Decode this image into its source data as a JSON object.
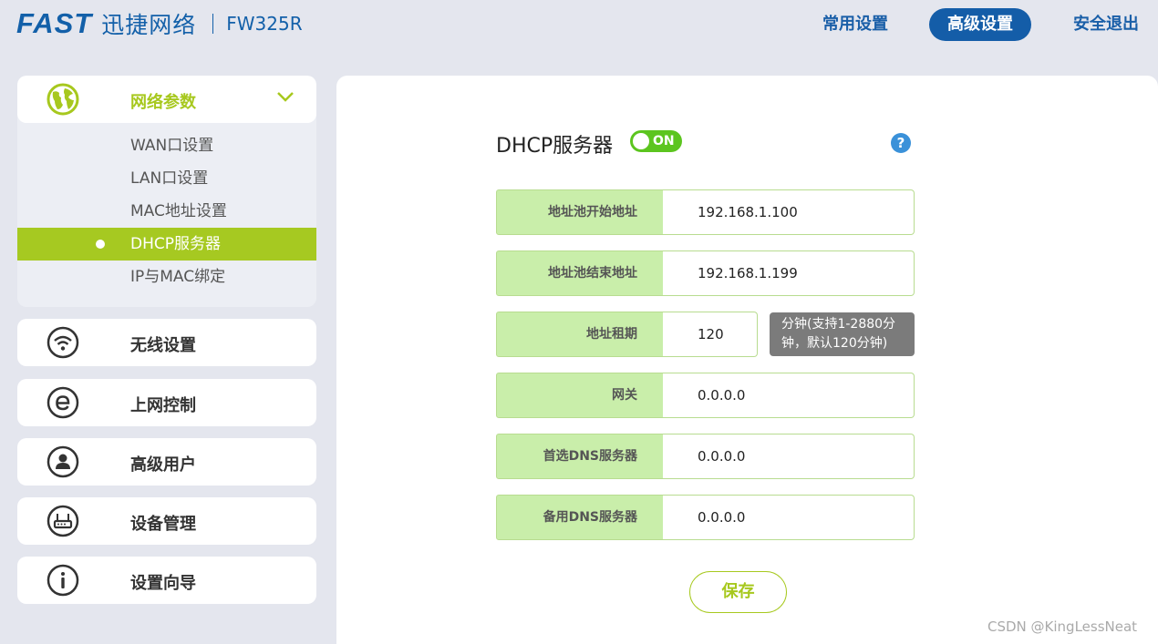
{
  "header": {
    "logo_brand": "FAST",
    "logo_cn": "迅捷网络",
    "model": "FW325R",
    "nav": {
      "common": "常用设置",
      "advanced": "高级设置",
      "logout": "安全退出"
    }
  },
  "sidebar": {
    "network": {
      "label": "网络参数",
      "icon": "globe-icon",
      "items": [
        "WAN口设置",
        "LAN口设置",
        "MAC地址设置",
        "DHCP服务器",
        "IP与MAC绑定"
      ],
      "active": "DHCP服务器"
    },
    "cards": [
      {
        "label": "无线设置",
        "icon": "wifi-icon"
      },
      {
        "label": "上网控制",
        "icon": "ie-icon"
      },
      {
        "label": "高级用户",
        "icon": "user-icon"
      },
      {
        "label": "设备管理",
        "icon": "router-icon"
      },
      {
        "label": "设置向导",
        "icon": "info-icon"
      }
    ]
  },
  "main": {
    "title": "DHCP服务器",
    "toggle": "ON",
    "help": "?",
    "fields": {
      "pool_start": {
        "label": "地址池开始地址",
        "value": "192.168.1.100"
      },
      "pool_end": {
        "label": "地址池结束地址",
        "value": "192.168.1.199"
      },
      "lease": {
        "label": "地址租期",
        "value": "120"
      },
      "gateway": {
        "label": "网关",
        "value": "0.0.0.0"
      },
      "dns_primary": {
        "label": "首选DNS服务器",
        "value": "0.0.0.0"
      },
      "dns_secondary": {
        "label": "备用DNS服务器",
        "value": "0.0.0.0"
      }
    },
    "lease_tip_line1": "分钟(支持1-2880分",
    "lease_tip_line2": "钟，默认120分钟)",
    "save": "保存"
  },
  "watermark": "CSDN @KingLessNeat",
  "colors": {
    "brand_blue": "#1360a9",
    "accent_green": "#a6c921",
    "label_bg": "#c9eeaa",
    "toggle_on": "#5cc51f"
  }
}
